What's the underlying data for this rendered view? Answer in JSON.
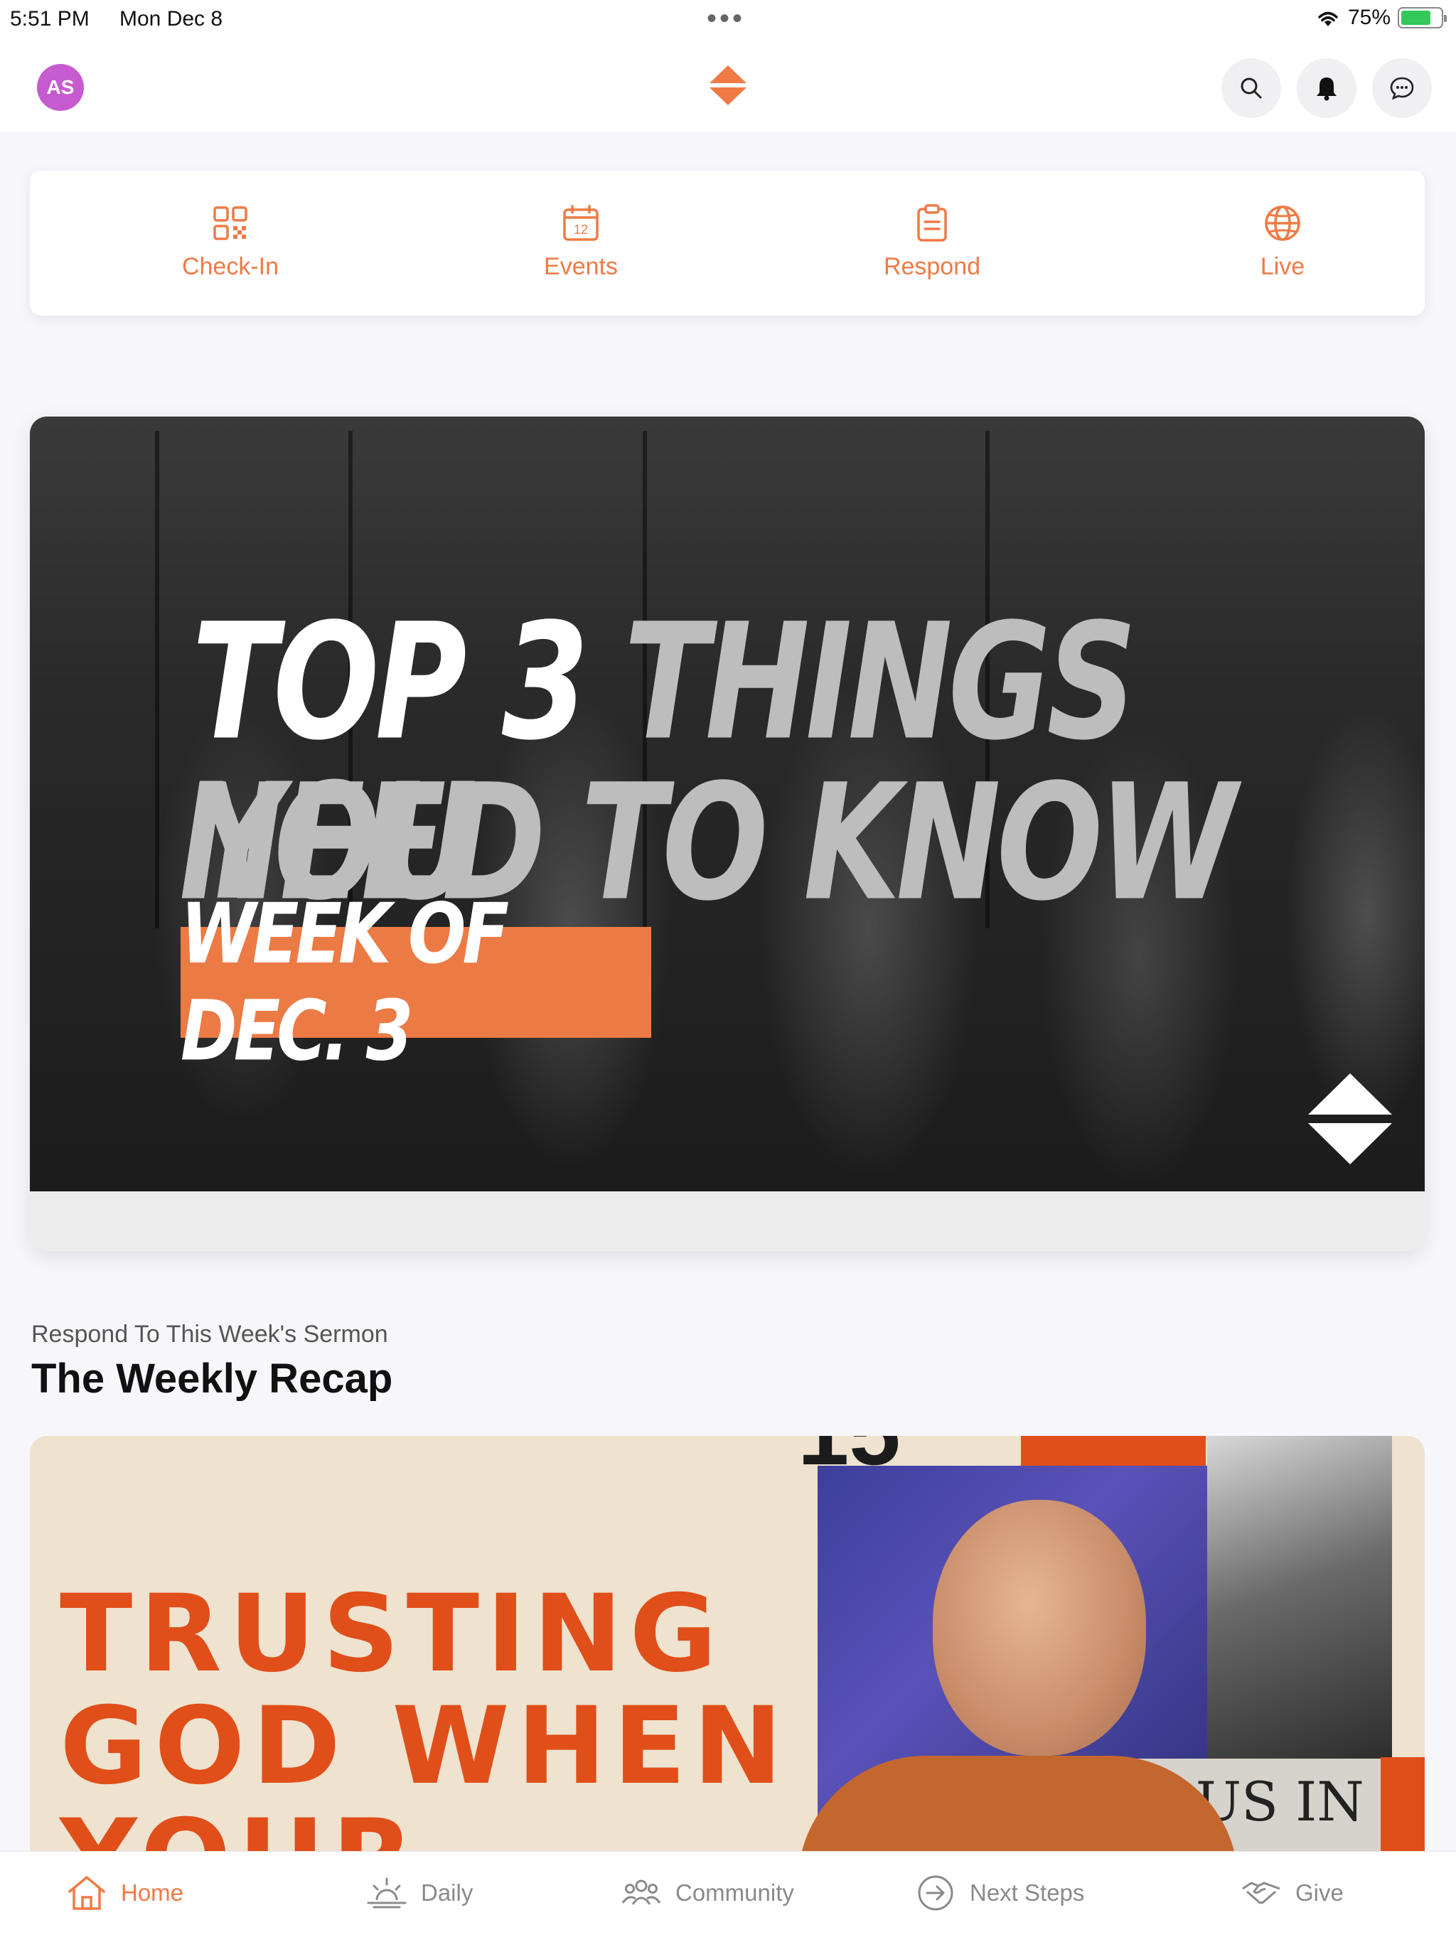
{
  "status_bar": {
    "time": "5:51 PM",
    "date": "Mon Dec 8",
    "battery": "75%",
    "battery_level": 0.75
  },
  "header": {
    "avatar_initials": "AS",
    "accent_color": "#ef7a45",
    "icons": [
      "search-icon",
      "bell-icon",
      "chat-icon"
    ]
  },
  "quick_actions": [
    {
      "label": "Check-In",
      "icon": "qr-code-icon"
    },
    {
      "label": "Events",
      "icon": "calendar-icon",
      "calendar_day": "12"
    },
    {
      "label": "Respond",
      "icon": "clipboard-icon"
    },
    {
      "label": "Live",
      "icon": "globe-icon"
    }
  ],
  "hero": {
    "line1_white": "TOP 3 ",
    "line1_gray": "THINGS YOU",
    "line2": "NEED TO KNOW",
    "tag": "WEEK OF DEC. 3"
  },
  "section": {
    "subtitle": "Respond To This Week's Sermon",
    "title": "The Weekly Recap"
  },
  "recap": {
    "line1": "TRUSTING",
    "line2": "GOD WHEN",
    "line3": "YOUR",
    "collage_text": "US IN"
  },
  "tabs": [
    {
      "label": "Home",
      "icon": "home-icon",
      "active": true
    },
    {
      "label": "Daily",
      "icon": "sunrise-icon",
      "active": false
    },
    {
      "label": "Community",
      "icon": "people-icon",
      "active": false
    },
    {
      "label": "Next Steps",
      "icon": "arrow-circle-icon",
      "active": false
    },
    {
      "label": "Give",
      "icon": "handshake-icon",
      "active": false
    }
  ]
}
